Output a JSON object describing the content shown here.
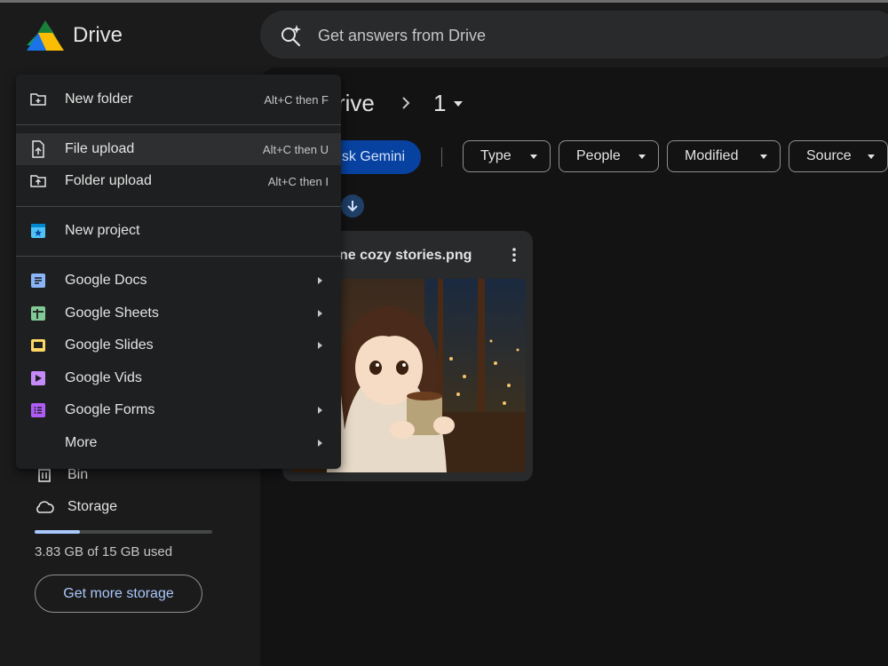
{
  "app": {
    "title": "Drive"
  },
  "search": {
    "placeholder": "Get answers from Drive"
  },
  "breadcrumb": {
    "root_partial": "rive",
    "folder": "1"
  },
  "toolbar": {
    "gemini_label_partial": "sk Gemini",
    "chips": [
      "Type",
      "People",
      "Modified",
      "Source"
    ]
  },
  "file": {
    "name_partial": "ne cozy stories.png"
  },
  "sidebar": {
    "bin_label": "Bin",
    "storage_label": "Storage",
    "storage_used_fraction": 0.255,
    "storage_text": "3.83 GB of 15 GB used",
    "get_more_storage": "Get more storage"
  },
  "menu": {
    "new_folder": {
      "label": "New folder",
      "shortcut": "Alt+C then F"
    },
    "file_upload": {
      "label": "File upload",
      "shortcut": "Alt+C then U"
    },
    "folder_upload": {
      "label": "Folder upload",
      "shortcut": "Alt+C then I"
    },
    "new_project": {
      "label": "New project"
    },
    "docs": {
      "label": "Google Docs",
      "color": "#8ab4f8"
    },
    "sheets": {
      "label": "Google Sheets",
      "color": "#81c995"
    },
    "slides": {
      "label": "Google Slides",
      "color": "#fdd663"
    },
    "vids": {
      "label": "Google Vids",
      "color": "#c58af9"
    },
    "forms": {
      "label": "Google Forms",
      "color": "#af5cf7"
    },
    "more": {
      "label": "More"
    }
  }
}
